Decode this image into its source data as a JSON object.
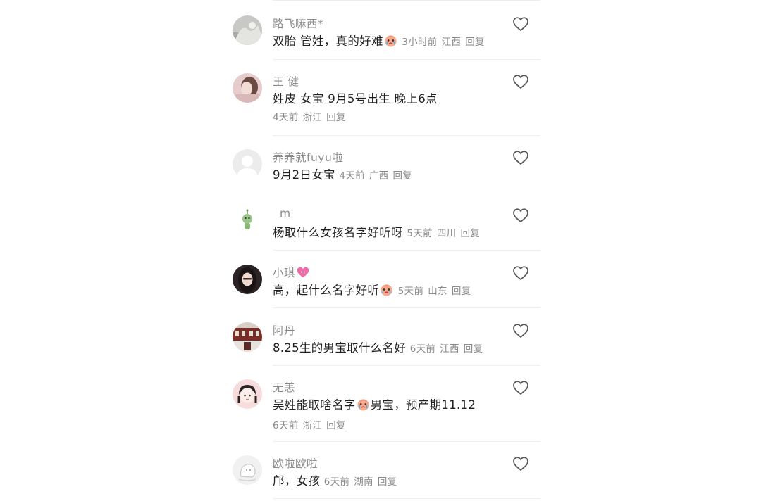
{
  "comments": [
    {
      "username": "路飞嘛西*",
      "text": "双胎 管姓，真的好难",
      "emoji": "crying-face-emoji",
      "time": "3小时前",
      "location": "江西",
      "reply": "回复"
    },
    {
      "username": "王 健",
      "text": "姓皮 女宝 9月5号出生 晚上6点",
      "time": "4天前",
      "location": "浙江",
      "reply": "回复"
    },
    {
      "username": "养养就fuyu啦",
      "text": "9月2日女宝",
      "time": "4天前",
      "location": "广西",
      "reply": "回复"
    },
    {
      "username": "m",
      "text": "杨取什么女孩名字好听呀",
      "time": "5天前",
      "location": "四川",
      "reply": "回复"
    },
    {
      "username": "小琪",
      "username_emoji": "heart-emoji",
      "text": "高，起什么名字好听",
      "emoji": "crying-face-emoji",
      "time": "5天前",
      "location": "山东",
      "reply": "回复"
    },
    {
      "username": "阿丹",
      "text": "8.25生的男宝取什么名好",
      "time": "6天前",
      "location": "江西",
      "reply": "回复"
    },
    {
      "username": "无恙",
      "text_before": "吴姓能取啥名字",
      "emoji": "crying-face-emoji",
      "text_after": "男宝，预产期11.12",
      "time": "6天前",
      "location": "浙江",
      "reply": "回复"
    },
    {
      "username": "欧啦欧啦",
      "text": "邝，女孩",
      "time": "6天前",
      "location": "湖南",
      "reply": "回复"
    }
  ],
  "colors": {
    "username": "#8a8a8a",
    "body": "#1f1f1f",
    "meta": "#8a8a8a",
    "divider": "#efefef"
  }
}
